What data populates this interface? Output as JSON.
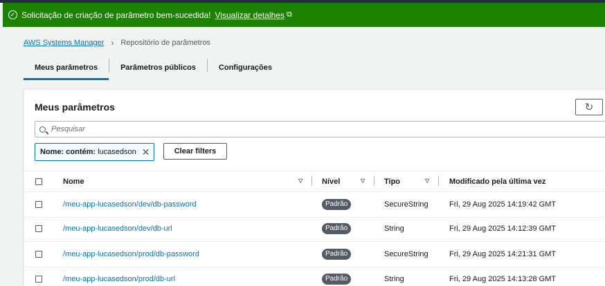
{
  "flash": {
    "message": "Solicitação de criação de parâmetro bem-sucedida!",
    "link_label": "Visualizar detalhes",
    "status_icon": "check-circle-icon",
    "external_icon": "external-link-icon",
    "color": "#1d8102"
  },
  "breadcrumb": {
    "root": "AWS Systems Manager",
    "current": "Repositório de parâmetros"
  },
  "tabs": [
    {
      "label": "Meus parâmetros",
      "active": true
    },
    {
      "label": "Parâmetros públicos",
      "active": false
    },
    {
      "label": "Configurações",
      "active": false
    }
  ],
  "panel": {
    "title": "Meus parâmetros",
    "refresh_icon": "refresh-icon"
  },
  "search": {
    "placeholder": "Pesquisar",
    "value": ""
  },
  "filter_token": {
    "label": "Nome: contém:",
    "value": "lucasedson"
  },
  "clear_filters_label": "Clear filters",
  "table": {
    "headers": {
      "name": "Nome",
      "tier": "Nível",
      "type": "Tipo",
      "modified": "Modificado pela última vez"
    },
    "rows": [
      {
        "name": "/meu-app-lucasedson/dev/db-password",
        "tier": "Padrão",
        "type": "SecureString",
        "modified": "Fri, 29 Aug 2025 14:19:42 GMT"
      },
      {
        "name": "/meu-app-lucasedson/dev/db-url",
        "tier": "Padrão",
        "type": "String",
        "modified": "Fri, 29 Aug 2025 14:12:39 GMT"
      },
      {
        "name": "/meu-app-lucasedson/prod/db-password",
        "tier": "Padrão",
        "type": "SecureString",
        "modified": "Fri, 29 Aug 2025 14:21:31 GMT"
      },
      {
        "name": "/meu-app-lucasedson/prod/db-url",
        "tier": "Padrão",
        "type": "String",
        "modified": "Fri, 29 Aug 2025 14:13:28 GMT"
      }
    ]
  },
  "colors": {
    "link": "#0073bb",
    "badge": "#545b64",
    "top_bar": "#232f3e"
  }
}
